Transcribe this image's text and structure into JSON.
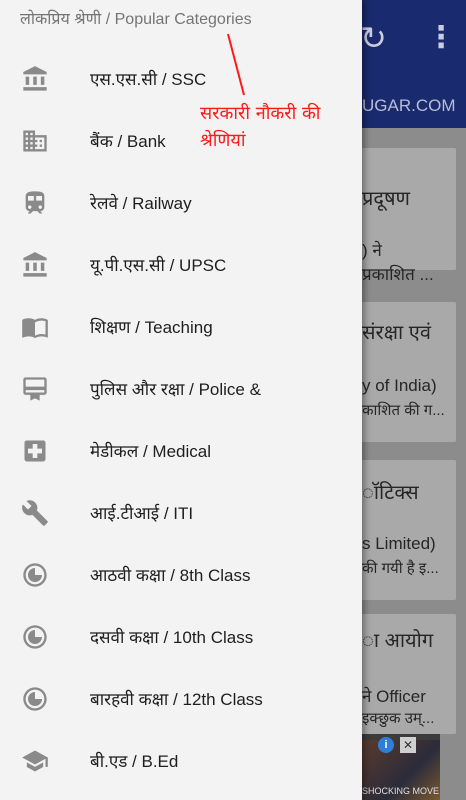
{
  "background": {
    "site_name": "UGAR.COM",
    "cards": [
      {
        "lines": [
          "प्रदूषण",
          ") ने",
          "प्रकाशित ..."
        ]
      },
      {
        "lines": [
          "संरक्षा एवं",
          "y of India)",
          "काशित की ग..."
        ]
      },
      {
        "lines": [
          "ॉटिक्स",
          "s Limited)",
          "की गयी है इ..."
        ]
      },
      {
        "lines": [
          "ा आयोग",
          "ने Officer",
          "इक्छुक उम्..."
        ]
      }
    ],
    "ad_text": "SHOCKING MOVE"
  },
  "drawer": {
    "header": "लोकप्रिय श्रेणी / Popular Categories",
    "items": [
      {
        "label": "एस.एस.सी / SSC",
        "icon": "bank-icon"
      },
      {
        "label": "बैंक / Bank",
        "icon": "building-icon"
      },
      {
        "label": "रेलवे / Railway",
        "icon": "train-icon"
      },
      {
        "label": "यू.पी.एस.सी / UPSC",
        "icon": "bank-icon"
      },
      {
        "label": "शिक्षण / Teaching",
        "icon": "book-icon"
      },
      {
        "label": "पुलिस और रक्षा / Police &",
        "icon": "badge-icon"
      },
      {
        "label": "मेडीकल / Medical",
        "icon": "medical-icon"
      },
      {
        "label": "आई.टीआई / ITI",
        "icon": "wrench-icon"
      },
      {
        "label": "आठवी कक्षा / 8th Class",
        "icon": "clock-icon"
      },
      {
        "label": "दसवी कक्षा / 10th Class",
        "icon": "clock-icon"
      },
      {
        "label": "बारहवी कक्षा / 12th Class",
        "icon": "clock-icon"
      },
      {
        "label": "बी.एड / B.Ed",
        "icon": "graduation-cap-icon"
      }
    ]
  },
  "annotation": {
    "line1": "सरकारी नौकरी की",
    "line2": "श्रेणियां",
    "color": "#ff1a1a"
  },
  "colors": {
    "toolbar": "#1a2a6e",
    "drawer_bg": "#f3f3f3",
    "icon": "#8a8a8a",
    "text": "#1e1e1e",
    "header_text": "#757575"
  }
}
